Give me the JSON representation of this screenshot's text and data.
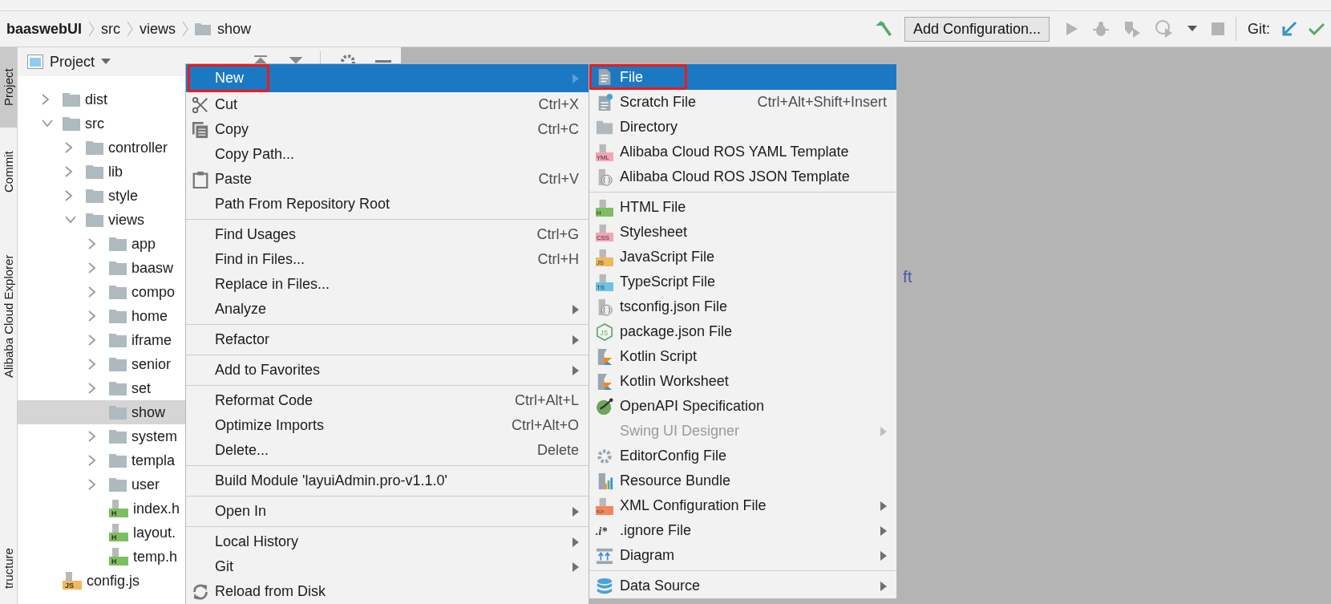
{
  "navbar": {
    "breadcrumb": [
      {
        "label": "baaswebUI",
        "kind": "project"
      },
      {
        "label": "src",
        "kind": "plain"
      },
      {
        "label": "views",
        "kind": "plain"
      },
      {
        "label": "show",
        "kind": "folder"
      }
    ],
    "config_button": "Add Configuration...",
    "run_actions_disabled": true,
    "git_label": "Git:"
  },
  "tool_strip": [
    {
      "label": "Project",
      "selected": true
    },
    {
      "label": "Commit",
      "selected": false
    },
    {
      "label": "Alibaba Cloud Explorer",
      "selected": false
    },
    {
      "label": "tructure",
      "selected": false
    }
  ],
  "project": {
    "title": "Project",
    "tree": [
      {
        "label": "dist",
        "kind": "folder",
        "expanded": false,
        "selected": false
      },
      {
        "label": "src",
        "kind": "folder",
        "expanded": true,
        "selected": false,
        "children": [
          {
            "label": "controller",
            "kind": "folder",
            "expanded": false,
            "selected": false
          },
          {
            "label": "lib",
            "kind": "folder",
            "expanded": false,
            "selected": false
          },
          {
            "label": "style",
            "kind": "folder",
            "expanded": false,
            "selected": false
          },
          {
            "label": "views",
            "kind": "folder",
            "expanded": true,
            "selected": false,
            "children": [
              {
                "label": "app",
                "kind": "folder",
                "expanded": false,
                "selected": false
              },
              {
                "label": "baasw",
                "kind": "folder",
                "expanded": false,
                "selected": false
              },
              {
                "label": "compo",
                "kind": "folder",
                "expanded": false,
                "selected": false
              },
              {
                "label": "home",
                "kind": "folder",
                "expanded": false,
                "selected": false
              },
              {
                "label": "iframe",
                "kind": "folder",
                "expanded": false,
                "selected": false
              },
              {
                "label": "senior",
                "kind": "folder",
                "expanded": false,
                "selected": false
              },
              {
                "label": "set",
                "kind": "folder",
                "expanded": false,
                "selected": false
              },
              {
                "label": "show",
                "kind": "folder",
                "selected": true
              },
              {
                "label": "system",
                "kind": "folder",
                "expanded": false,
                "selected": false
              },
              {
                "label": "templa",
                "kind": "folder",
                "expanded": false,
                "selected": false
              },
              {
                "label": "user",
                "kind": "folder",
                "expanded": false,
                "selected": false
              },
              {
                "label": "index.h",
                "kind": "file",
                "badge": "H",
                "color": "#7cbf5e",
                "selected": false
              },
              {
                "label": "layout.",
                "kind": "file",
                "badge": "H",
                "color": "#7cbf5e",
                "selected": false
              },
              {
                "label": "temp.h",
                "kind": "file",
                "badge": "H",
                "color": "#7cbf5e",
                "selected": false
              }
            ]
          }
        ]
      },
      {
        "label": "config.js",
        "kind": "file",
        "badge": "JS",
        "color": "#f2b85c",
        "selected": false
      }
    ]
  },
  "editor_hint": "ft",
  "context_menu": {
    "groups": [
      [
        {
          "label": "New",
          "submenu": true,
          "selected": true,
          "highlighted": true
        },
        {
          "label": "Cut",
          "kind": "scissors",
          "shortcut": "Ctrl+X",
          "selected": false
        },
        {
          "label": "Copy",
          "kind": "copy",
          "shortcut": "Ctrl+C",
          "selected": false
        },
        {
          "label": "Copy Path...",
          "selected": false
        },
        {
          "label": "Paste",
          "kind": "paste",
          "shortcut": "Ctrl+V",
          "selected": false
        },
        {
          "label": "Path From Repository Root",
          "selected": false
        }
      ],
      [
        {
          "label": "Find Usages",
          "shortcut": "Ctrl+G",
          "selected": false
        },
        {
          "label": "Find in Files...",
          "shortcut": "Ctrl+H",
          "selected": false
        },
        {
          "label": "Replace in Files...",
          "selected": false
        },
        {
          "label": "Analyze",
          "submenu": true,
          "selected": false
        }
      ],
      [
        {
          "label": "Refactor",
          "submenu": true,
          "selected": false
        }
      ],
      [
        {
          "label": "Add to Favorites",
          "submenu": true,
          "selected": false
        }
      ],
      [
        {
          "label": "Reformat Code",
          "shortcut": "Ctrl+Alt+L",
          "selected": false
        },
        {
          "label": "Optimize Imports",
          "shortcut": "Ctrl+Alt+O",
          "selected": false
        },
        {
          "label": "Delete...",
          "shortcut": "Delete",
          "selected": false
        }
      ],
      [
        {
          "label": "Build Module 'layuiAdmin.pro-v1.1.0'",
          "selected": false
        }
      ],
      [
        {
          "label": "Open In",
          "submenu": true,
          "selected": false
        }
      ],
      [
        {
          "label": "Local History",
          "submenu": true,
          "selected": false
        },
        {
          "label": "Git",
          "submenu": true,
          "selected": false
        },
        {
          "label": "Reload from Disk",
          "kind": "reload",
          "selected": false
        }
      ]
    ]
  },
  "new_submenu": {
    "groups": [
      [
        {
          "label": "File",
          "kind": "doc",
          "selected": true,
          "highlighted": true
        },
        {
          "label": "Scratch File",
          "kind": "scratch",
          "shortcut": "Ctrl+Alt+Shift+Insert",
          "selected": false
        },
        {
          "label": "Directory",
          "kind": "folder",
          "selected": false
        },
        {
          "label": "Alibaba Cloud ROS YAML Template",
          "kind": "badge",
          "badge": "YML",
          "color": "#f4a3b4",
          "selected": false
        },
        {
          "label": "Alibaba Cloud ROS JSON Template",
          "kind": "json",
          "selected": false
        }
      ],
      [
        {
          "label": "HTML File",
          "kind": "badge",
          "badge": "H",
          "color": "#7cbf5e",
          "selected": false
        },
        {
          "label": "Stylesheet",
          "kind": "badge",
          "badge": "CSS",
          "color": "#f4a3b4",
          "selected": false
        },
        {
          "label": "JavaScript File",
          "kind": "badge",
          "badge": "JS",
          "color": "#f2b85c",
          "selected": false
        },
        {
          "label": "TypeScript File",
          "kind": "badge",
          "badge": "TS",
          "color": "#6cc3e4",
          "selected": false
        },
        {
          "label": "tsconfig.json File",
          "kind": "json",
          "selected": false
        },
        {
          "label": "package.json File",
          "kind": "hexjs",
          "badge": "JS",
          "selected": false
        },
        {
          "label": "Kotlin Script",
          "kind": "kotlin",
          "selected": false
        },
        {
          "label": "Kotlin Worksheet",
          "kind": "kotlin",
          "selected": false
        },
        {
          "label": "OpenAPI Specification",
          "kind": "openapi",
          "selected": false
        },
        {
          "label": "Swing UI Designer",
          "submenu": true,
          "disabled": true,
          "selected": false
        },
        {
          "label": "EditorConfig File",
          "kind": "gear",
          "selected": false
        },
        {
          "label": "Resource Bundle",
          "kind": "bundle",
          "selected": false
        },
        {
          "label": "XML Configuration File",
          "kind": "badge",
          "badge": "<>",
          "color": "#f0875a",
          "submenu": true,
          "selected": false
        },
        {
          "label": ".ignore File",
          "kind": "text",
          "badge": ".i*",
          "submenu": true,
          "selected": false
        },
        {
          "label": "Diagram",
          "kind": "diagram",
          "submenu": true,
          "selected": false
        }
      ],
      [
        {
          "label": "Data Source",
          "kind": "database",
          "submenu": true,
          "selected": false
        }
      ]
    ]
  }
}
